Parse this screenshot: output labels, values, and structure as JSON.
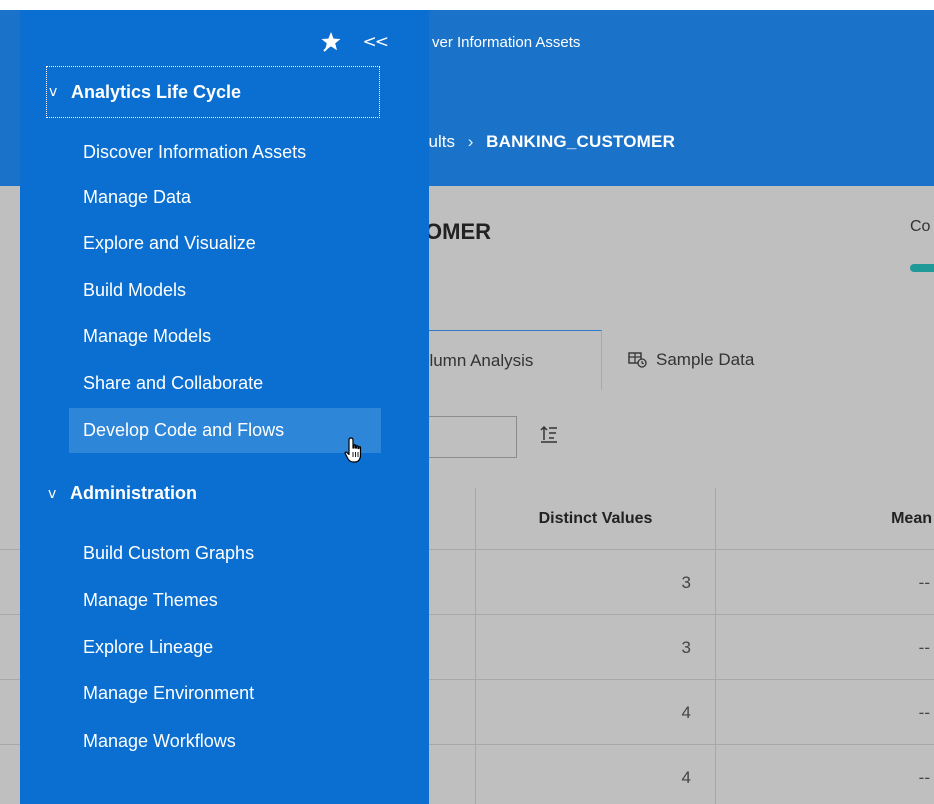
{
  "header": {
    "app_title": "Discover Information Assets",
    "app_title_visible": "ver Information Assets",
    "breadcrumb": {
      "prev_visible": "sults",
      "separator": "›",
      "current": "BANKING_CUSTOMER"
    }
  },
  "page": {
    "title_visible": "OMER",
    "complete_label_visible": "Co",
    "progress": 0
  },
  "tabs": [
    {
      "label_visible": "olumn Analysis",
      "active": true
    },
    {
      "label": "Sample Data",
      "icon": "table-icon",
      "active": false
    }
  ],
  "toolbar": {
    "filter_value": "",
    "sort_icon": "sort-icon"
  },
  "grid": {
    "columns": [
      "Distinct Values",
      "Mean"
    ],
    "rows": [
      {
        "distinct": "3",
        "mean": "--"
      },
      {
        "distinct": "3",
        "mean": "--"
      },
      {
        "distinct": "4",
        "mean": "--"
      },
      {
        "distinct": "4",
        "mean": "--"
      }
    ]
  },
  "nav": {
    "pin_icon": "pin-icon",
    "collapse_icon": "double-chevron-left-icon",
    "collapse_glyph": "<<",
    "sections": [
      {
        "title": "Analytics Life Cycle",
        "chevron": "v",
        "items": [
          {
            "label": "Discover Information Assets"
          },
          {
            "label": "Manage Data"
          },
          {
            "label": "Explore and Visualize"
          },
          {
            "label": "Build Models"
          },
          {
            "label": "Manage Models"
          },
          {
            "label": "Share and Collaborate"
          },
          {
            "label": "Develop Code and Flows",
            "hovered": true
          }
        ]
      },
      {
        "title": "Administration",
        "chevron": "v",
        "items": [
          {
            "label": "Build Custom Graphs"
          },
          {
            "label": "Manage Themes"
          },
          {
            "label": "Explore Lineage"
          },
          {
            "label": "Manage Environment"
          },
          {
            "label": "Manage Workflows"
          }
        ]
      }
    ]
  },
  "colors": {
    "nav_bg": "#0a6fd1",
    "nav_hover": "#2e86d8",
    "topbar": "#1a73c8",
    "overlay_gray": "#bfbfbf",
    "accent_teal": "#1f9a98"
  }
}
